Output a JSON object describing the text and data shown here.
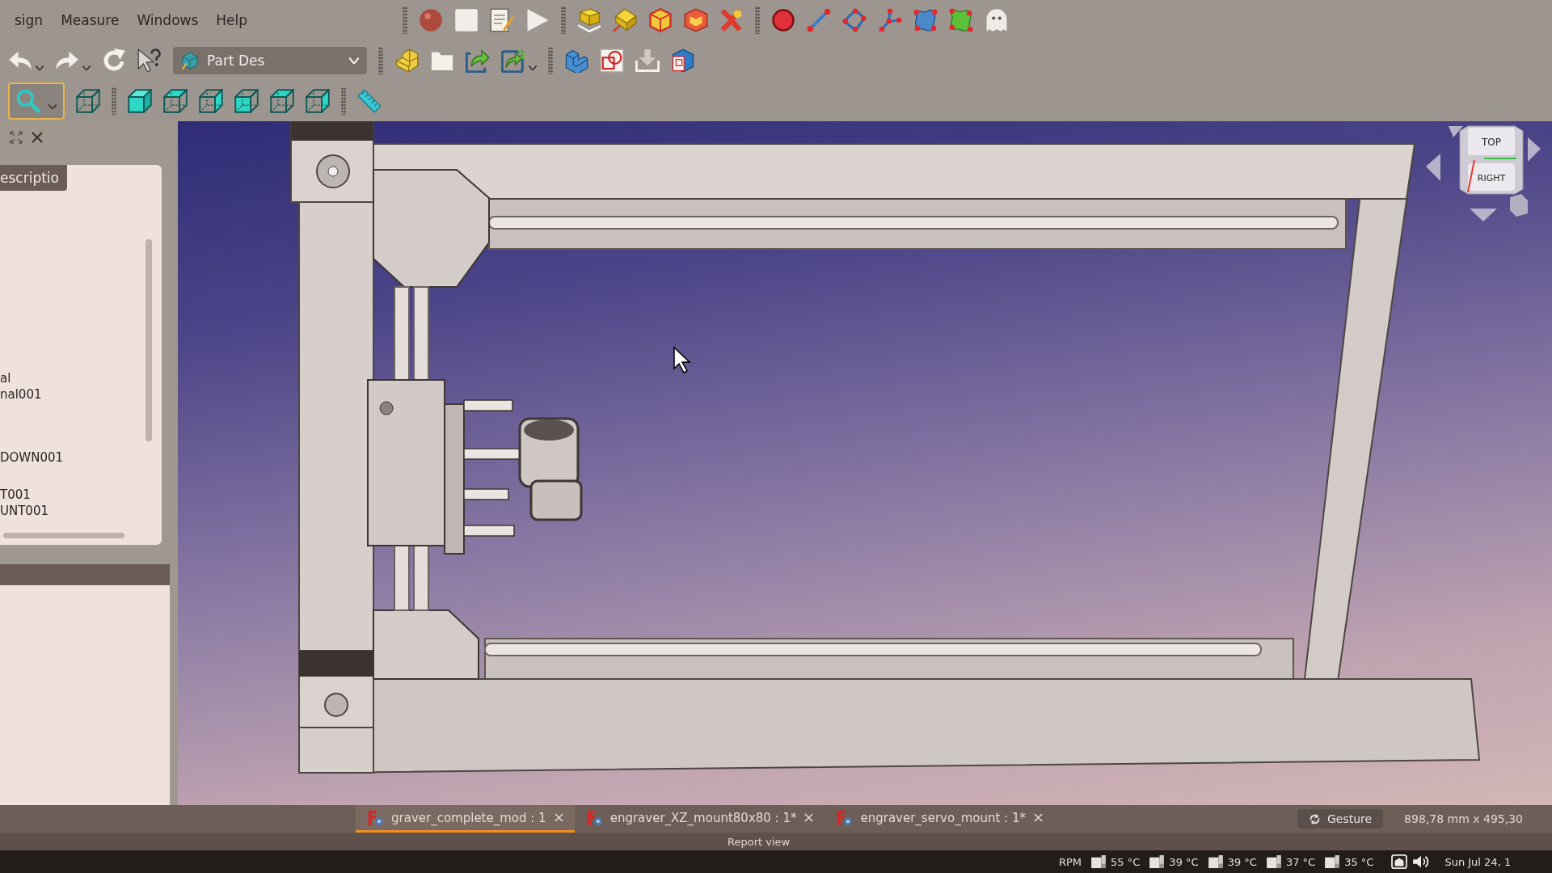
{
  "menu_bar": {
    "items": [
      "sign",
      "Measure",
      "Windows",
      "Help"
    ]
  },
  "toolbar": {
    "workbench": "Part Des"
  },
  "combo_view": {
    "tree_header": "escriptio",
    "items": [
      "al",
      "nal001",
      "DOWN001",
      "T001",
      "UNT001"
    ]
  },
  "navigation_cube": {
    "top_face": "TOP",
    "front_face": "RIGHT"
  },
  "document_tabs": [
    {
      "label": "graver_complete_mod : 1",
      "selected": true
    },
    {
      "label": "engraver_XZ_mount80x80 : 1*",
      "selected": false
    },
    {
      "label": "engraver_servo_mount : 1*",
      "selected": false
    }
  ],
  "status_bar": {
    "navigation_style": "Gesture",
    "dimensions": "898,78 mm x 495,30"
  },
  "report_view": {
    "title": "Report view"
  },
  "taskbar": {
    "fan_unit": "RPM",
    "temperatures": [
      "55 °C",
      "39 °C",
      "39 °C",
      "37 °C",
      "35 °C"
    ],
    "clock": "Sun Jul 24, 1"
  }
}
